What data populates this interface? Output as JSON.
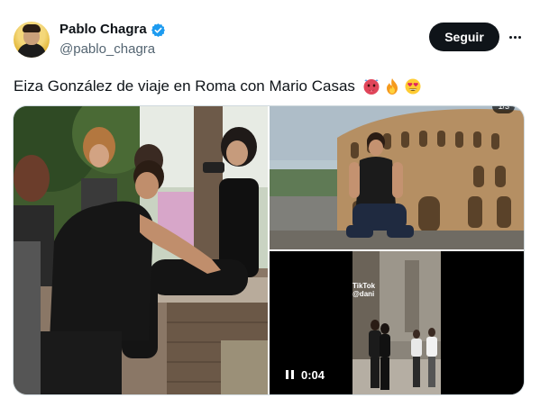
{
  "author": {
    "display_name": "Pablo Chagra",
    "handle": "@pablo_chagra",
    "verified": true,
    "verified_color": "#1d9bf0"
  },
  "actions": {
    "follow_label": "Seguir",
    "more_icon": "more-horizontal-icon"
  },
  "tweet": {
    "text": "Eiza González de viaje en Roma con Mario Casas",
    "emojis": [
      "hot-face-emoji",
      "fire-emoji",
      "heart-eyes-emoji"
    ]
  },
  "media": {
    "items": [
      {
        "kind": "photo",
        "name": "friends-on-wall-photo"
      },
      {
        "kind": "photo",
        "name": "man-at-colosseum-photo",
        "counter": "1/3"
      },
      {
        "kind": "video",
        "name": "rome-street-video",
        "duration": "0:04",
        "watermark": "TikTok",
        "watermark_sub": "@dani"
      }
    ]
  },
  "colors": {
    "text_primary": "#0f1419",
    "text_secondary": "#536471",
    "border": "#cfd9de",
    "button_bg": "#0f1419"
  }
}
